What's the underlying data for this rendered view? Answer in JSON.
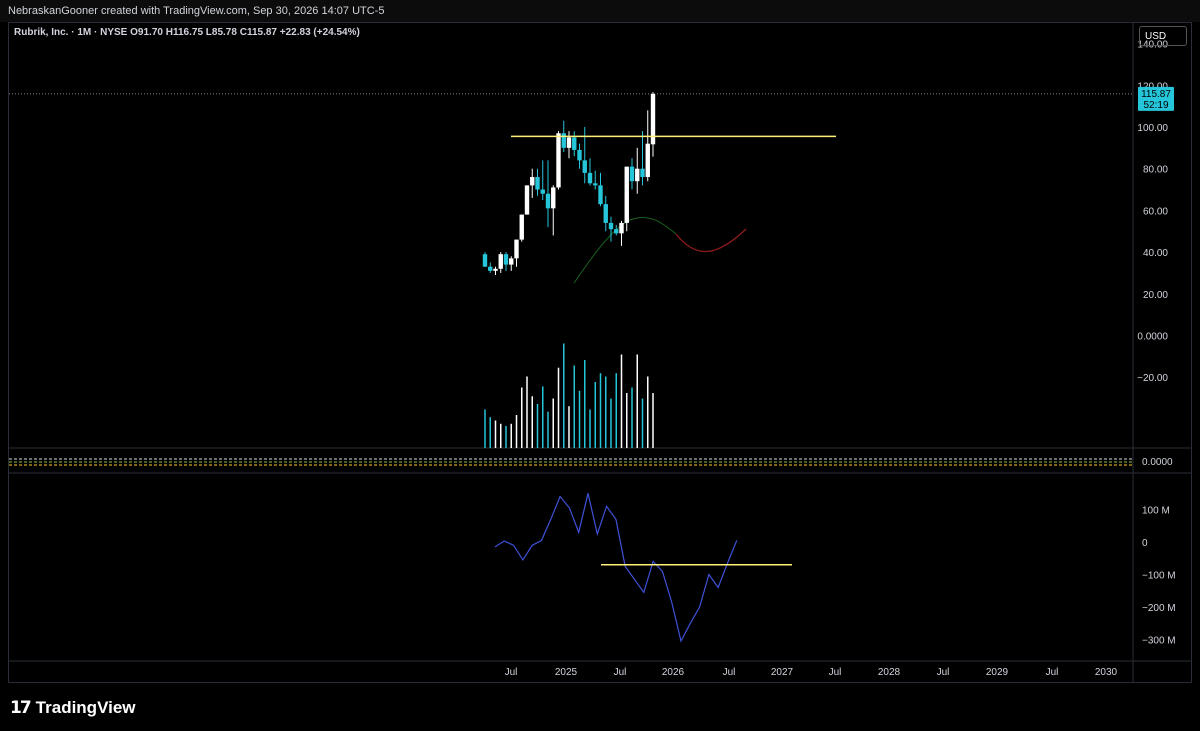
{
  "header": {
    "attribution": "NebraskanGooner created with TradingView.com, Sep 30, 2026 14:07 UTC-5"
  },
  "legend": {
    "symbol": "Rubrik, Inc. · 1M · NYSE",
    "o_label": "O",
    "o_value": "91.70",
    "h_label": "H",
    "h_value": "116.75",
    "l_label": "L",
    "l_value": "85.78",
    "c_label": "C",
    "c_value": "115.87",
    "change": "+22.83 (+24.54%)"
  },
  "currency_button": "USD",
  "price_tag": {
    "price": "115.87",
    "countdown": "52:19"
  },
  "footer": {
    "brand": "TradingView"
  },
  "colors": {
    "up": "#ffffff",
    "down": "#26c6da",
    "hline": "#fff176",
    "ma_green": "#1b5e20",
    "ma_red": "#8b1a1a",
    "osc": "#3f51d8",
    "grid_border": "#2a2e39",
    "axis_text": "#d1d4dc",
    "tag_bg": "#26c6da"
  },
  "chart_data": {
    "type": "candlestick",
    "price_axis": {
      "ticks": [
        "140.00",
        "120.00",
        "100.00",
        "80.00",
        "60.00",
        "40.00",
        "20.00",
        "0.0000",
        "−20.00"
      ],
      "range": [
        -30,
        150
      ]
    },
    "time_axis": {
      "ticks": [
        "Jul",
        "2025",
        "Jul",
        "2026",
        "Jul",
        "2027",
        "Jul",
        "2028",
        "Jul",
        "2029",
        "Jul",
        "2030"
      ]
    },
    "candles": [
      {
        "o": 39,
        "h": 40,
        "l": 33,
        "c": 33
      },
      {
        "o": 33,
        "h": 35,
        "l": 30,
        "c": 31
      },
      {
        "o": 31,
        "h": 33,
        "l": 29,
        "c": 32
      },
      {
        "o": 32,
        "h": 40,
        "l": 30,
        "c": 39
      },
      {
        "o": 39,
        "h": 40,
        "l": 31,
        "c": 34
      },
      {
        "o": 34,
        "h": 38,
        "l": 31,
        "c": 37
      },
      {
        "o": 37,
        "h": 46,
        "l": 33,
        "c": 46
      },
      {
        "o": 46,
        "h": 58,
        "l": 45,
        "c": 58
      },
      {
        "o": 58,
        "h": 72,
        "l": 58,
        "c": 72
      },
      {
        "o": 72,
        "h": 80,
        "l": 66,
        "c": 76
      },
      {
        "o": 76,
        "h": 80,
        "l": 67,
        "c": 70
      },
      {
        "o": 70,
        "h": 84,
        "l": 65,
        "c": 68
      },
      {
        "o": 68,
        "h": 84,
        "l": 52,
        "c": 61
      },
      {
        "o": 61,
        "h": 72,
        "l": 48,
        "c": 71
      },
      {
        "o": 71,
        "h": 98,
        "l": 70,
        "c": 97
      },
      {
        "o": 97,
        "h": 103,
        "l": 88,
        "c": 90
      },
      {
        "o": 90,
        "h": 98,
        "l": 85,
        "c": 95
      },
      {
        "o": 95,
        "h": 98,
        "l": 86,
        "c": 89
      },
      {
        "o": 89,
        "h": 92,
        "l": 80,
        "c": 84
      },
      {
        "o": 84,
        "h": 100,
        "l": 73,
        "c": 78
      },
      {
        "o": 78,
        "h": 85,
        "l": 72,
        "c": 73
      },
      {
        "o": 73,
        "h": 79,
        "l": 70,
        "c": 72
      },
      {
        "o": 72,
        "h": 78,
        "l": 62,
        "c": 63
      },
      {
        "o": 63,
        "h": 67,
        "l": 50,
        "c": 54
      },
      {
        "o": 54,
        "h": 57,
        "l": 45,
        "c": 51
      },
      {
        "o": 51,
        "h": 53,
        "l": 48,
        "c": 49
      },
      {
        "o": 49,
        "h": 55,
        "l": 43,
        "c": 54
      },
      {
        "o": 54,
        "h": 80,
        "l": 50,
        "c": 81
      },
      {
        "o": 81,
        "h": 85,
        "l": 70,
        "c": 74
      },
      {
        "o": 74,
        "h": 90,
        "l": 68,
        "c": 80
      },
      {
        "o": 80,
        "h": 98,
        "l": 72,
        "c": 76
      },
      {
        "o": 76,
        "h": 108,
        "l": 74,
        "c": 92
      },
      {
        "o": 91.7,
        "h": 116.75,
        "l": 85.78,
        "c": 115.87
      }
    ],
    "horizontal_line_price": 95.5,
    "volume_relative": [
      0.35,
      0.28,
      0.25,
      0.22,
      0.2,
      0.22,
      0.3,
      0.55,
      0.65,
      0.47,
      0.4,
      0.56,
      0.33,
      0.45,
      0.73,
      0.95,
      0.38,
      0.75,
      0.52,
      0.8,
      0.35,
      0.6,
      0.68,
      0.65,
      0.45,
      0.68,
      0.85,
      0.5,
      0.55,
      0.85,
      0.45,
      0.65,
      0.5
    ],
    "oscillator": {
      "ticks": [
        "100 M",
        "0",
        "−100 M",
        "−200 M",
        "−300 M"
      ],
      "values": [
        -15,
        3,
        -10,
        -55,
        -10,
        5,
        70,
        140,
        105,
        30,
        150,
        25,
        110,
        70,
        -75,
        -115,
        -155,
        -60,
        -90,
        -185,
        -305,
        -250,
        -200,
        -100,
        -140,
        -65,
        5
      ],
      "horizontal_line": -70
    },
    "pane_separator_value": "0.0000"
  }
}
